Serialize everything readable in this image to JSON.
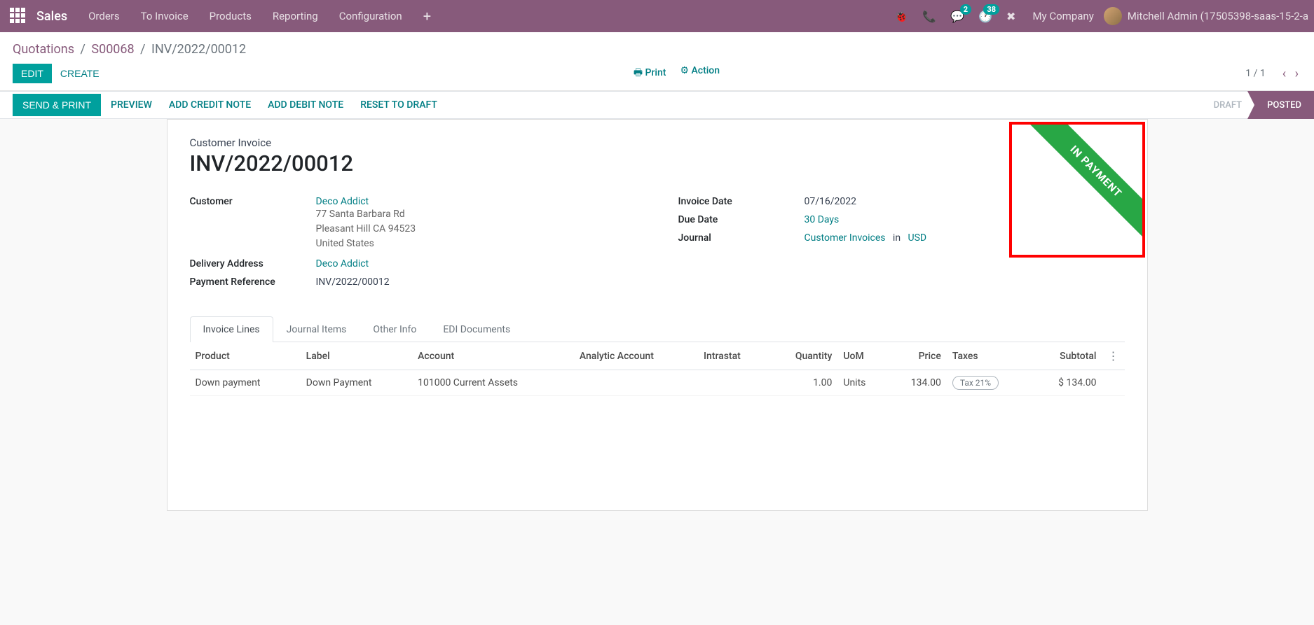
{
  "topbar": {
    "brand": "Sales",
    "menu": [
      "Orders",
      "To Invoice",
      "Products",
      "Reporting",
      "Configuration"
    ],
    "messages_badge": "2",
    "activities_badge": "38",
    "company": "My Company",
    "user": "Mitchell Admin (17505398-saas-15-2-a"
  },
  "breadcrumb": {
    "items": [
      "Quotations",
      "S00068"
    ],
    "current": "INV/2022/00012"
  },
  "cp": {
    "edit": "EDIT",
    "create": "CREATE",
    "print": "Print",
    "action": "Action",
    "pager": "1 / 1"
  },
  "statusbar": {
    "send_print": "SEND & PRINT",
    "buttons": [
      "PREVIEW",
      "ADD CREDIT NOTE",
      "ADD DEBIT NOTE",
      "RESET TO DRAFT"
    ],
    "stages": {
      "draft": "DRAFT",
      "posted": "POSTED"
    }
  },
  "ribbon": "IN PAYMENT",
  "invoice": {
    "type_label": "Customer Invoice",
    "name": "INV/2022/00012",
    "labels": {
      "customer": "Customer",
      "delivery": "Delivery Address",
      "payref": "Payment Reference",
      "inv_date": "Invoice Date",
      "due_date": "Due Date",
      "journal": "Journal"
    },
    "customer_name": "Deco Addict",
    "address_line1": "77 Santa Barbara Rd",
    "address_line2": "Pleasant Hill CA 94523",
    "address_line3": "United States",
    "delivery_address": "Deco Addict",
    "payment_reference": "INV/2022/00012",
    "invoice_date": "07/16/2022",
    "due_date": "30 Days",
    "journal": "Customer Invoices",
    "journal_in": "in",
    "currency": "USD"
  },
  "tabs": [
    "Invoice Lines",
    "Journal Items",
    "Other Info",
    "EDI Documents"
  ],
  "table": {
    "headers": {
      "product": "Product",
      "label": "Label",
      "account": "Account",
      "analytic": "Analytic Account",
      "intrastat": "Intrastat",
      "quantity": "Quantity",
      "uom": "UoM",
      "price": "Price",
      "taxes": "Taxes",
      "subtotal": "Subtotal"
    },
    "rows": [
      {
        "product": "Down payment",
        "label": "Down Payment",
        "account": "101000 Current Assets",
        "analytic": "",
        "intrastat": "",
        "quantity": "1.00",
        "uom": "Units",
        "price": "134.00",
        "tax": "Tax 21%",
        "subtotal": "$ 134.00"
      }
    ]
  }
}
